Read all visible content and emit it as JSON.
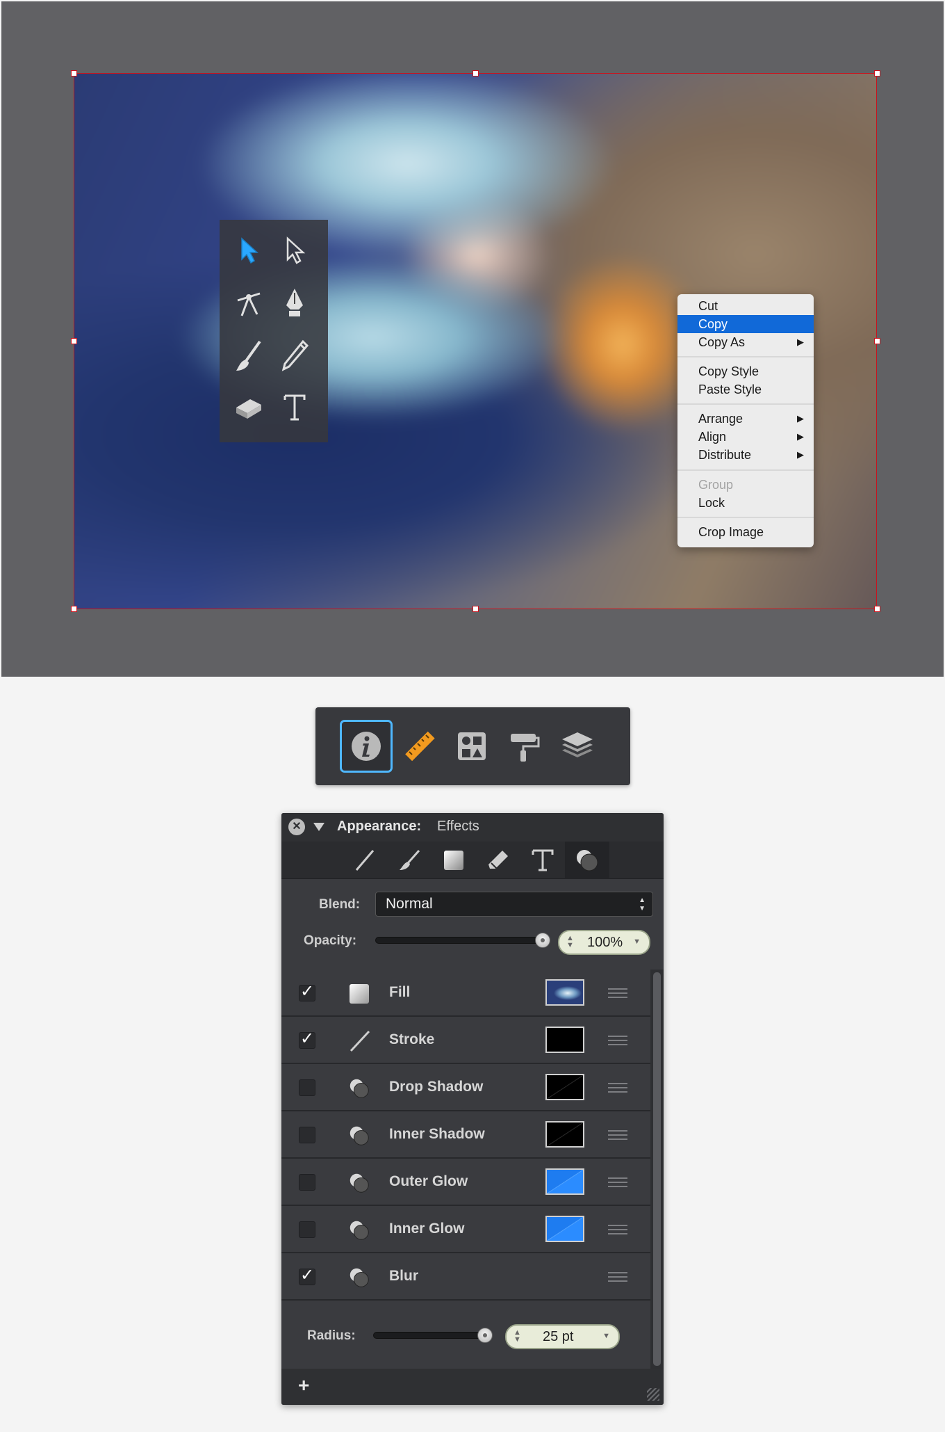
{
  "context_menu": {
    "items": [
      {
        "label": "Cut"
      },
      {
        "label": "Copy"
      },
      {
        "label": "Copy As"
      },
      {
        "label": "Copy Style"
      },
      {
        "label": "Paste Style"
      },
      {
        "label": "Arrange"
      },
      {
        "label": "Align"
      },
      {
        "label": "Distribute"
      },
      {
        "label": "Group"
      },
      {
        "label": "Lock"
      },
      {
        "label": "Crop Image"
      }
    ],
    "highlighted": "Copy",
    "disabled": [
      "Group"
    ],
    "submenu_arrow": "▶"
  },
  "tools": [
    "select-arrow-icon",
    "direct-select-arrow-icon",
    "vector-tool-icon",
    "pen-tool-icon",
    "brush-tool-icon",
    "pencil-tool-icon",
    "eraser-tool-icon",
    "text-tool-icon"
  ],
  "inspector_bar": {
    "buttons": [
      "info-icon",
      "ruler-icon",
      "shapes-icon",
      "paint-roller-icon",
      "layers-icon"
    ],
    "active": "info-icon",
    "accent": "#4fb8ff"
  },
  "appearance": {
    "title": "Appearance:",
    "subtitle": "Effects",
    "close_glyph": "✕",
    "style_tabs": [
      "stroke-tab-icon",
      "brush-tab-icon",
      "fill-tab-icon",
      "eraser-tab-icon",
      "text-tab-icon",
      "effects-tab-icon"
    ],
    "active_tab": "effects-tab-icon",
    "blend_label": "Blend:",
    "blend_value": "Normal",
    "opacity_label": "Opacity:",
    "opacity_value": "100%",
    "opacity_fraction": 1.0,
    "effects": [
      {
        "name": "Fill",
        "checked": true,
        "check_glyph": "✓",
        "swatch": "image"
      },
      {
        "name": "Stroke",
        "checked": true,
        "check_glyph": "✓",
        "swatch": "#000000"
      },
      {
        "name": "Drop Shadow",
        "checked": false,
        "check_glyph": "",
        "swatch": "black-diagonal"
      },
      {
        "name": "Inner Shadow",
        "checked": false,
        "check_glyph": "",
        "swatch": "black-diagonal"
      },
      {
        "name": "Outer Glow",
        "checked": false,
        "check_glyph": "",
        "swatch": "blue-diagonal"
      },
      {
        "name": "Inner Glow",
        "checked": false,
        "check_glyph": "",
        "swatch": "blue-diagonal"
      },
      {
        "name": "Blur",
        "checked": true,
        "check_glyph": "✓",
        "swatch": "none"
      }
    ],
    "radius_label": "Radius:",
    "radius_value": "25 pt",
    "add_glyph": "+"
  },
  "colors": {
    "selection": "#c8141e",
    "menu_highlight": "#1169d8",
    "glow_blue": "#2b8cff",
    "tool_accent": "#2aa8ff"
  }
}
